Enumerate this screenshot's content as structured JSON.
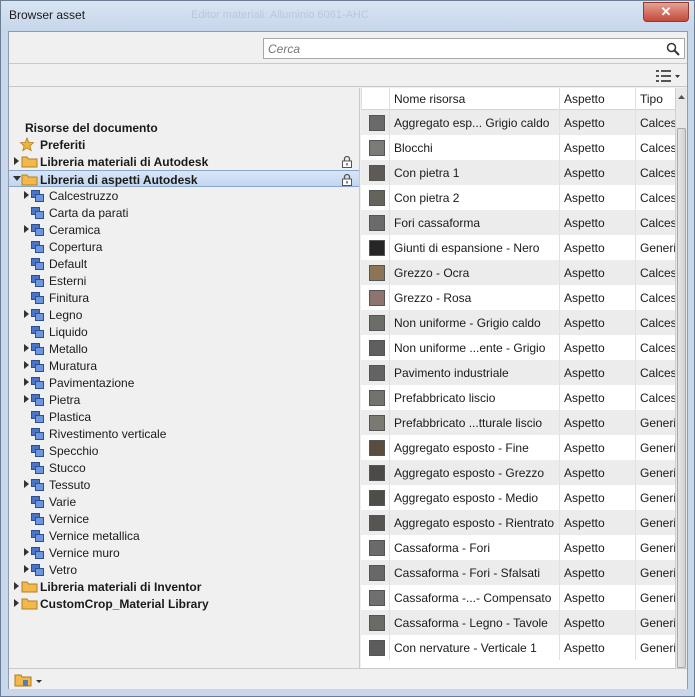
{
  "window": {
    "title": "Browser asset",
    "close_label": "✕",
    "ghost_title": "Editor materiali: Alluminio 6061-AHC"
  },
  "search": {
    "placeholder": "Cerca"
  },
  "tree": {
    "document_resources": "Risorse del documento",
    "favorites": "Preferiti",
    "libraries": [
      {
        "label": "Libreria materiali di Autodesk",
        "locked": true,
        "expanded": false
      },
      {
        "label": "Libreria di aspetti Autodesk",
        "locked": true,
        "expanded": true,
        "selected": true
      },
      {
        "label": "Libreria materiali di Inventor",
        "locked": false,
        "expanded": false
      },
      {
        "label": "CustomCrop_Material Library",
        "locked": false,
        "expanded": false
      }
    ],
    "categories": [
      {
        "label": "Calcestruzzo",
        "has_children": true
      },
      {
        "label": "Carta da parati",
        "has_children": false
      },
      {
        "label": "Ceramica",
        "has_children": true
      },
      {
        "label": "Copertura",
        "has_children": false
      },
      {
        "label": "Default",
        "has_children": false
      },
      {
        "label": "Esterni",
        "has_children": false
      },
      {
        "label": "Finitura",
        "has_children": false
      },
      {
        "label": "Legno",
        "has_children": true
      },
      {
        "label": "Liquido",
        "has_children": false
      },
      {
        "label": "Metallo",
        "has_children": true
      },
      {
        "label": "Muratura",
        "has_children": true
      },
      {
        "label": "Pavimentazione",
        "has_children": true
      },
      {
        "label": "Pietra",
        "has_children": true
      },
      {
        "label": "Plastica",
        "has_children": false
      },
      {
        "label": "Rivestimento verticale",
        "has_children": false
      },
      {
        "label": "Specchio",
        "has_children": false
      },
      {
        "label": "Stucco",
        "has_children": false
      },
      {
        "label": "Tessuto",
        "has_children": true
      },
      {
        "label": "Varie",
        "has_children": false
      },
      {
        "label": "Vernice",
        "has_children": false
      },
      {
        "label": "Vernice metallica",
        "has_children": false
      },
      {
        "label": "Vernice muro",
        "has_children": true
      },
      {
        "label": "Vetro",
        "has_children": true
      }
    ]
  },
  "grid": {
    "columns": [
      "Nome risorsa",
      "Aspetto",
      "Tipo"
    ],
    "rows": [
      {
        "name": "Aggregato esp... Grigio caldo",
        "aspect": "Aspetto",
        "type": "Calces",
        "color": "#6a6a6a"
      },
      {
        "name": "Blocchi",
        "aspect": "Aspetto",
        "type": "Calces",
        "color": "#7b7b78"
      },
      {
        "name": "Con pietra 1",
        "aspect": "Aspetto",
        "type": "Calces",
        "color": "#5e5a55"
      },
      {
        "name": "Con pietra 2",
        "aspect": "Aspetto",
        "type": "Calces",
        "color": "#66625c"
      },
      {
        "name": "Fori cassaforma",
        "aspect": "Aspetto",
        "type": "Calces",
        "color": "#6b6b6b"
      },
      {
        "name": "Giunti di espansione - Nero",
        "aspect": "Aspetto",
        "type": "Generi",
        "color": "#262626"
      },
      {
        "name": "Grezzo - Ocra",
        "aspect": "Aspetto",
        "type": "Calces",
        "color": "#8c7456"
      },
      {
        "name": "Grezzo - Rosa",
        "aspect": "Aspetto",
        "type": "Calces",
        "color": "#8e7470"
      },
      {
        "name": "Non uniforme - Grigio caldo",
        "aspect": "Aspetto",
        "type": "Calces",
        "color": "#6e6c69"
      },
      {
        "name": "Non uniforme ...ente - Grigio",
        "aspect": "Aspetto",
        "type": "Calces",
        "color": "#5f5f5f"
      },
      {
        "name": "Pavimento industriale",
        "aspect": "Aspetto",
        "type": "Calces",
        "color": "#636363"
      },
      {
        "name": "Prefabbricato liscio",
        "aspect": "Aspetto",
        "type": "Calces",
        "color": "#73736d"
      },
      {
        "name": "Prefabbricato ...tturale liscio",
        "aspect": "Aspetto",
        "type": "Generi",
        "color": "#7a7a72"
      },
      {
        "name": "Aggregato esposto - Fine",
        "aspect": "Aspetto",
        "type": "Generi",
        "color": "#5a4c3e"
      },
      {
        "name": "Aggregato esposto - Grezzo",
        "aspect": "Aspetto",
        "type": "Generi",
        "color": "#4c4a47"
      },
      {
        "name": "Aggregato esposto - Medio",
        "aspect": "Aspetto",
        "type": "Generi",
        "color": "#4f4d48"
      },
      {
        "name": "Aggregato esposto - Rientrato",
        "aspect": "Aspetto",
        "type": "Generi",
        "color": "#575552"
      },
      {
        "name": "Cassaforma - Fori",
        "aspect": "Aspetto",
        "type": "Generi",
        "color": "#6a6a6a"
      },
      {
        "name": "Cassaforma - Fori - Sfalsati",
        "aspect": "Aspetto",
        "type": "Generi",
        "color": "#686868"
      },
      {
        "name": "Cassaforma -...- Compensato",
        "aspect": "Aspetto",
        "type": "Generi",
        "color": "#707070"
      },
      {
        "name": "Cassaforma - Legno - Tavole",
        "aspect": "Aspetto",
        "type": "Generi",
        "color": "#6c6a66"
      },
      {
        "name": "Con nervature - Verticale 1",
        "aspect": "Aspetto",
        "type": "Generi",
        "color": "#5c5c5c"
      }
    ]
  }
}
